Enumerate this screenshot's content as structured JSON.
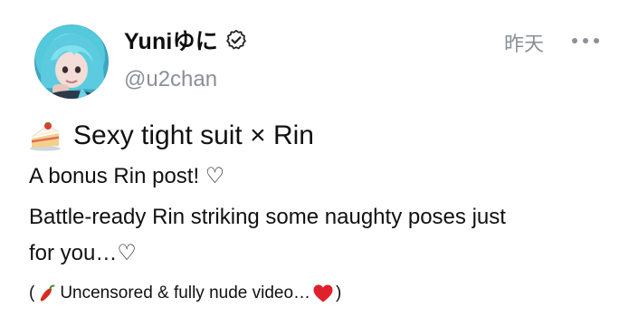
{
  "post": {
    "author": {
      "display_name": "Yuniゆに",
      "handle": "@u2chan",
      "avatar_icon": "avatar-photo",
      "verified_icon": "verified-badge-icon"
    },
    "time": "昨天",
    "more_icon": "more-dots-icon",
    "title": {
      "icon": "cake-icon",
      "text": "Sexy tight suit × Rin"
    },
    "body": {
      "line1": "A bonus Rin post! ♡",
      "line2": "Battle-ready Rin striking some naughty poses just",
      "line3": "for you…♡"
    },
    "footer": {
      "open_paren": "(",
      "chili_icon": "chili-pepper-icon",
      "text": " Uncensored & fully nude video…",
      "heart_icon": "red-heart-icon",
      "close_paren": ")"
    },
    "colors": {
      "text": "#111111",
      "muted": "#8a8f98",
      "heart": "#e0202b",
      "chili": "#d9291c"
    }
  }
}
